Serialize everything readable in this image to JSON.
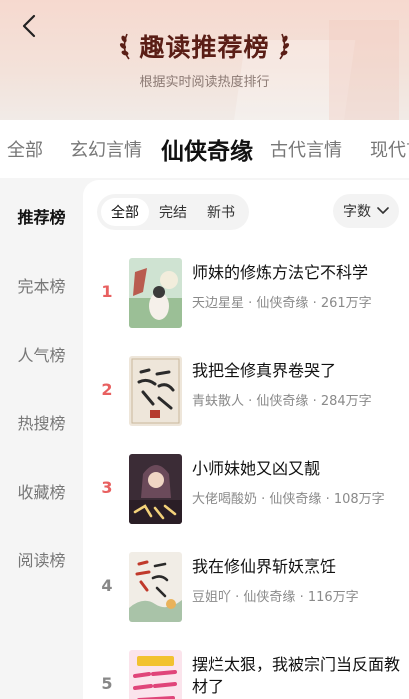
{
  "header": {
    "title": "趣读推荐榜",
    "subtitle": "根据实时阅读热度排行"
  },
  "categories": [
    "全部",
    "玄幻言情",
    "仙侠奇缘",
    "古代言情",
    "现代言"
  ],
  "sidebar": [
    "推荐榜",
    "完本榜",
    "人气榜",
    "热搜榜",
    "收藏榜",
    "阅读榜"
  ],
  "filters": [
    "全部",
    "完结",
    "新书"
  ],
  "sort_label": "字数",
  "books": [
    {
      "rank": "1",
      "title": "师妹的修炼方法它不科学",
      "author": "天边星星",
      "genre": "仙侠奇缘",
      "words": "261万字"
    },
    {
      "rank": "2",
      "title": "我把全修真界卷哭了",
      "author": "青蚨散人",
      "genre": "仙侠奇缘",
      "words": "284万字"
    },
    {
      "rank": "3",
      "title": "小师妹她又凶又靓",
      "author": "大佬喝酸奶",
      "genre": "仙侠奇缘",
      "words": "108万字"
    },
    {
      "rank": "4",
      "title": "我在修仙界斩妖烹饪",
      "author": "豆姐吖",
      "genre": "仙侠奇缘",
      "words": "116万字"
    },
    {
      "rank": "5",
      "title": "摆烂太狠，我被宗门当反面教材了",
      "author": "",
      "genre": "",
      "words": ""
    }
  ],
  "meta_sep": " · ",
  "colors": {
    "accent_rank": "#e86060",
    "title_dark": "#5a1e16"
  }
}
